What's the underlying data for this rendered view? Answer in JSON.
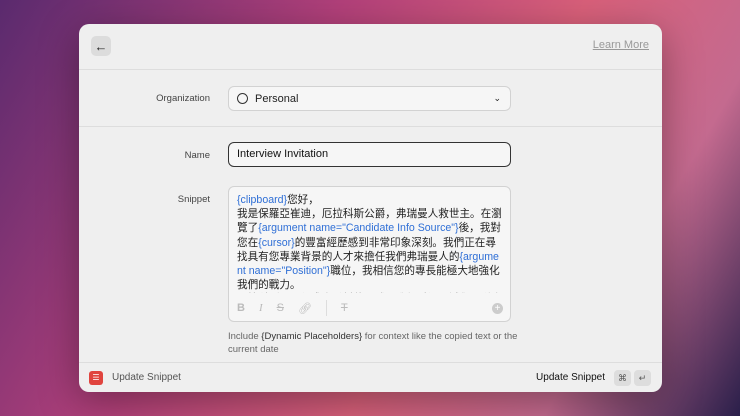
{
  "header": {
    "back_icon": "arrow-left",
    "learn_more": "Learn More"
  },
  "organization": {
    "label": "Organization",
    "value": "Personal",
    "icon": "person-circle"
  },
  "name": {
    "label": "Name",
    "value": "Interview Invitation"
  },
  "snippet": {
    "label": "Snippet",
    "segments": [
      {
        "t": "{clipboard}",
        "ph": true
      },
      {
        "t": "您好，\n我是保羅亞崔迪，厄拉科斯公爵，弗瑞曼人救世主。在瀏覽了"
      },
      {
        "t": "{argument name=\"Candidate Info Source\"}",
        "ph": true
      },
      {
        "t": "後，我對您在"
      },
      {
        "t": "{cursor}",
        "ph": true
      },
      {
        "t": "的豐富經歷感到非常印象深刻。我們正在尋找具有您專業背景的人才來擔任我們弗瑞曼人的"
      },
      {
        "t": "{argument name=\"Position\"}",
        "ph": true
      },
      {
        "t": "職位，我相信您的專長能極大地強化我們的戰力。\n厄拉科斯是一個盛產香料的星球，我們重視忠誠與團隊合作"
      }
    ],
    "toolbar": [
      "B",
      "I",
      "S",
      "link",
      "clear-format"
    ],
    "hint_pre": "Include ",
    "hint_bold": "{Dynamic Placeholders}",
    "hint_post": " for context like the copied text or the current date"
  },
  "footer": {
    "title": "Update Snippet",
    "action": "Update Snippet",
    "key1": "⌘",
    "key2": "↵"
  }
}
